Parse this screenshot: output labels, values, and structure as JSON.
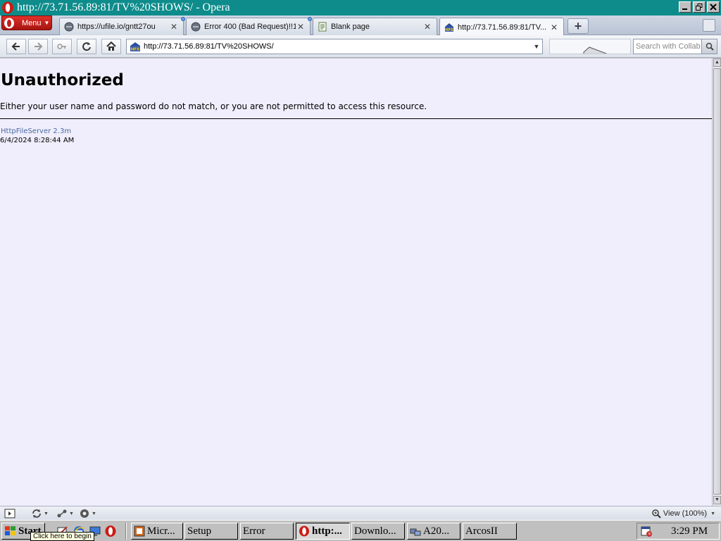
{
  "window": {
    "title": "http://73.71.56.89:81/TV%20SHOWS/ - Opera"
  },
  "menu": {
    "label": "Menu"
  },
  "tabs": [
    {
      "label": "https://ufile.io/gntt27ou",
      "icon": "globe-icon"
    },
    {
      "label": "Error 400 (Bad Request)!!1",
      "icon": "globe-icon"
    },
    {
      "label": "Blank page",
      "icon": "page-icon"
    },
    {
      "label": "http://73.71.56.89:81/TV...",
      "icon": "hfs-icon",
      "active": true
    }
  ],
  "address": {
    "url": "http://73.71.56.89:81/TV%20SHOWS/"
  },
  "search": {
    "placeholder": "Search with Collab"
  },
  "page": {
    "heading": "Unauthorized",
    "message": "Either your user name and password do not match, or you are not permitted to access this resource.",
    "server_link": "HttpFileServer 2.3m",
    "timestamp": "6/4/2024 8:28:44 AM",
    "background": "#f0eefc",
    "link_color": "#4a6aa0"
  },
  "statusbar": {
    "zoom_label": "View (100%)"
  },
  "taskbar": {
    "start_label": "Start",
    "start_tooltip": "Click here to begin",
    "buttons": [
      {
        "label": "Micr...",
        "icon": "office-icon"
      },
      {
        "label": "Setup",
        "icon": ""
      },
      {
        "label": "Error",
        "icon": ""
      },
      {
        "label": "http:...",
        "icon": "opera-icon",
        "active": true
      },
      {
        "label": "Downlo...",
        "icon": ""
      },
      {
        "label": "A20...",
        "icon": "network-icon"
      },
      {
        "label": "ArcosII",
        "icon": ""
      }
    ],
    "clock": "3:29 PM"
  },
  "colors": {
    "titlebar": "#0e8c8c",
    "opera_red": "#cc1b14"
  }
}
